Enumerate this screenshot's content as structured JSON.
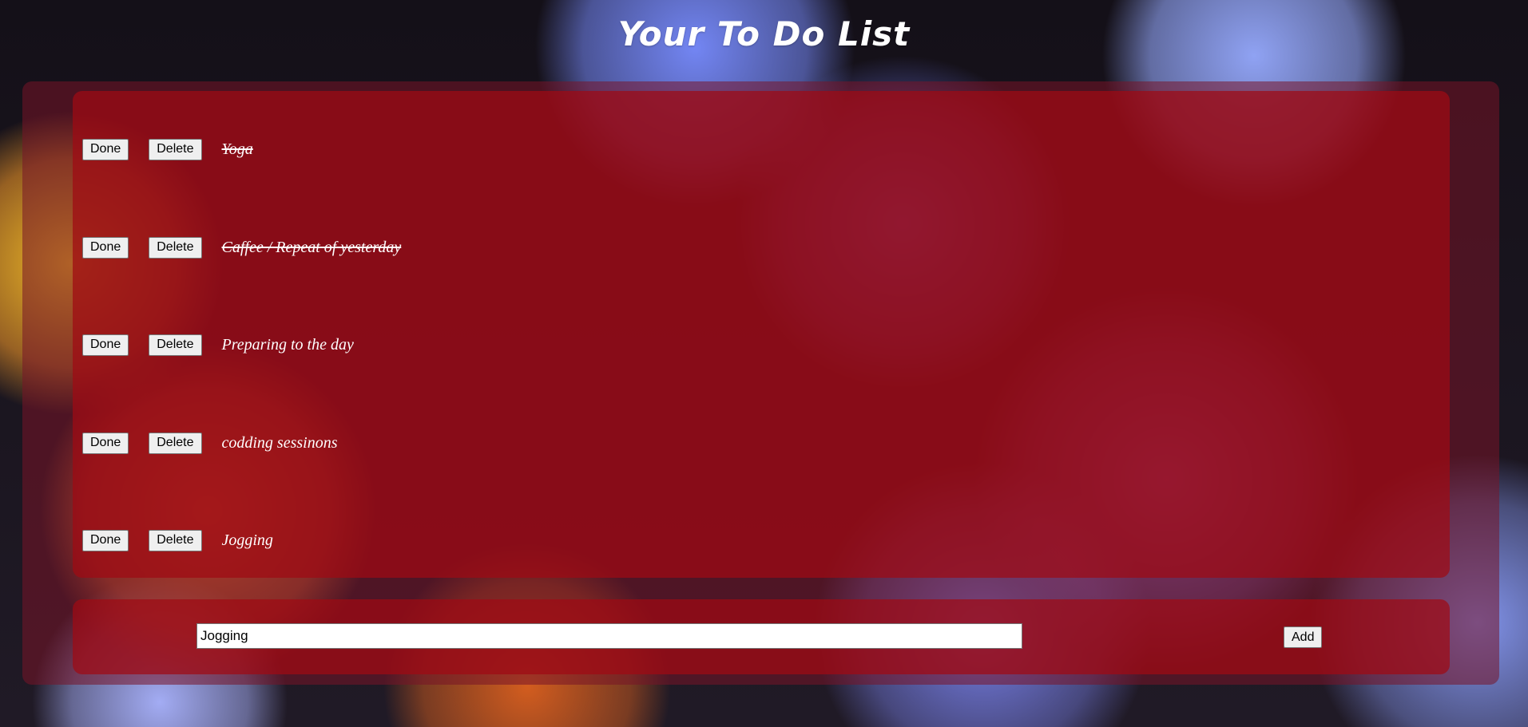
{
  "page": {
    "title": "Your To Do List"
  },
  "tasks": [
    {
      "text": "Yoga",
      "done": true,
      "done_label": "Done",
      "delete_label": "Delete"
    },
    {
      "text": "Caffee / Repeat of yesterday",
      "done": true,
      "done_label": "Done",
      "delete_label": "Delete"
    },
    {
      "text": "Preparing to the day",
      "done": false,
      "done_label": "Done",
      "delete_label": "Delete"
    },
    {
      "text": "codding sessinons",
      "done": false,
      "done_label": "Done",
      "delete_label": "Delete"
    },
    {
      "text": "Jogging",
      "done": false,
      "done_label": "Done",
      "delete_label": "Delete"
    }
  ],
  "add_form": {
    "input_value": "Jogging",
    "add_label": "Add"
  },
  "colors": {
    "panel": "#a00a14",
    "text": "#ffffff"
  }
}
